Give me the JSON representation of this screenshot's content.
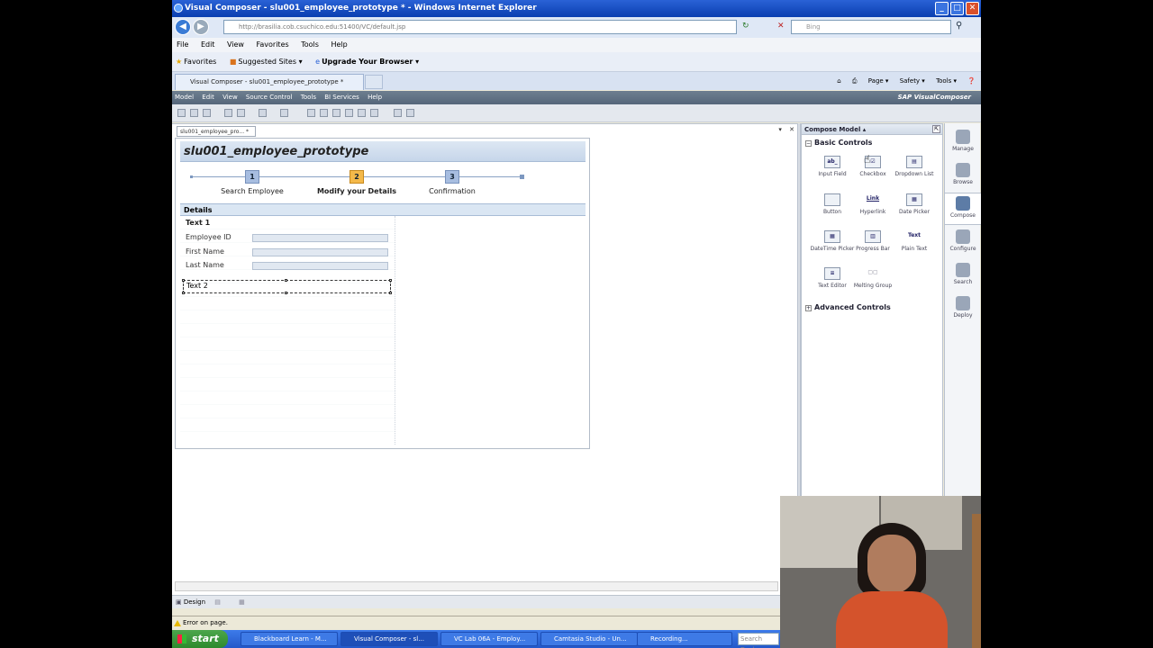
{
  "window": {
    "title": "Visual Composer - slu001_employee_prototype * - Windows Internet Explorer",
    "min": "_",
    "max": "□",
    "close": "✕"
  },
  "browser": {
    "address": "http://brasilia.cob.csuchico.edu:51400/VC/default.jsp",
    "search_placeholder": "Bing",
    "menu": [
      "File",
      "Edit",
      "View",
      "Favorites",
      "Tools",
      "Help"
    ],
    "favorites": {
      "favorites_label": "Favorites",
      "suggested_sites": "Suggested Sites ▾",
      "upgrade": "Upgrade Your Browser ▾"
    },
    "tab_title": "Visual Composer - slu001_employee_prototype *",
    "command_bar": [
      "Page ▾",
      "Safety ▾",
      "Tools ▾"
    ]
  },
  "vc": {
    "menu": [
      "Model",
      "Edit",
      "View",
      "Source Control",
      "Tools",
      "BI Services",
      "Help"
    ],
    "brand": "SAP VisualComposer",
    "doc_tab": "slu001_employee_pro... *",
    "app_title": "slu001_employee_prototype",
    "roadmap": [
      {
        "num": "1",
        "label": "Search Employee",
        "active": false
      },
      {
        "num": "2",
        "label": "Modify your Details",
        "active": true
      },
      {
        "num": "3",
        "label": "Confirmation",
        "active": false
      }
    ],
    "details": {
      "header": "Details",
      "text1": "Text 1",
      "fields": [
        "Employee ID",
        "First Name",
        "Last Name"
      ],
      "text2": "Text 2"
    },
    "bottom_tab": "Design"
  },
  "compose": {
    "header": "Compose Model ▴",
    "basic_section": "Basic Controls",
    "advanced_section": "Advanced Controls",
    "controls": [
      {
        "label": "Input Field",
        "icon": "ab_",
        "icon_name": "input-field-icon"
      },
      {
        "label": "Checkbox",
        "icon": "☑",
        "icon_name": "checkbox-icon"
      },
      {
        "label": "Dropdown List",
        "icon": "▤",
        "icon_name": "dropdown-icon"
      },
      {
        "label": "Button",
        "icon": "",
        "icon_name": "button-icon"
      },
      {
        "label": "Hyperlink",
        "icon": "Link",
        "icon_name": "hyperlink-icon"
      },
      {
        "label": "Date Picker",
        "icon": "▦",
        "icon_name": "calendar-icon"
      },
      {
        "label": "DateTime Picker",
        "icon": "▦",
        "icon_name": "datetime-icon"
      },
      {
        "label": "Progress Bar",
        "icon": "▥",
        "icon_name": "progress-icon"
      },
      {
        "label": "Plain Text",
        "icon": "Text",
        "icon_name": "text-icon"
      },
      {
        "label": "Text Editor",
        "icon": "≡",
        "icon_name": "text-editor-icon"
      },
      {
        "label": "Melting Group",
        "icon": "▢▢",
        "icon_name": "group-icon"
      }
    ]
  },
  "sidebar": [
    {
      "label": "Manage",
      "active": false
    },
    {
      "label": "Browse",
      "active": false
    },
    {
      "label": "Compose",
      "active": true
    },
    {
      "label": "Configure",
      "active": false
    },
    {
      "label": "Search",
      "active": false
    },
    {
      "label": "Deploy",
      "active": false
    }
  ],
  "status": {
    "text": "Error on page."
  },
  "taskbar": {
    "start": "start",
    "items": [
      {
        "label": "Blackboard Learn - M...",
        "active": false
      },
      {
        "label": "Visual Composer - sl...",
        "active": true
      },
      {
        "label": "VC Lab 06A - Employ...",
        "active": false
      },
      {
        "label": "Camtasia Studio - Un...",
        "active": false
      },
      {
        "label": "Recording...",
        "active": false
      }
    ],
    "search_placeholder": "Search Desk"
  }
}
